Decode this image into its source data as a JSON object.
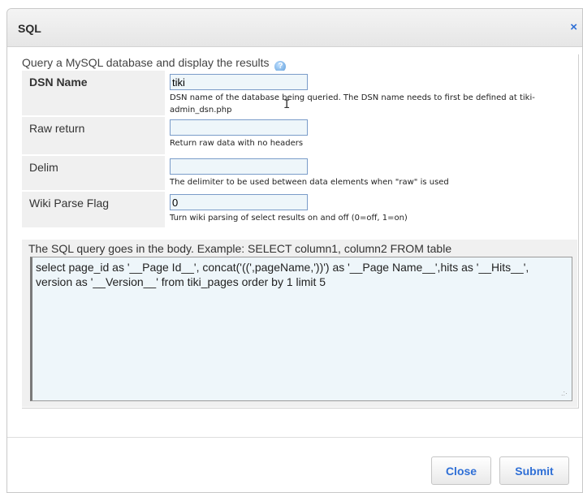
{
  "dialog": {
    "title": "SQL",
    "close_icon": "×"
  },
  "intro": {
    "text": "Query a MySQL database and display the results",
    "help_icon": "?"
  },
  "params": [
    {
      "label": "DSN Name",
      "value": "tiki",
      "help": "DSN name of the database being queried. The DSN name needs to first be defined at tiki-admin_dsn.php"
    },
    {
      "label": "Raw return",
      "value": "",
      "help": "Return raw data with no headers"
    },
    {
      "label": "Delim",
      "value": "",
      "help": "The delimiter to be used between data elements when \"raw\" is used"
    },
    {
      "label": "Wiki Parse Flag",
      "value": "0",
      "help": "Turn wiki parsing of select results on and off (0=off, 1=on)"
    }
  ],
  "body": {
    "label": "The SQL query goes in the body. Example: SELECT column1, column2 FROM table",
    "value": "select page_id as '__Page Id__', concat('((',pageName,'))') as '__Page Name__',hits as '__Hits__', version as '__Version__' from tiki_pages order by 1 limit 5"
  },
  "buttons": {
    "close": "Close",
    "submit": "Submit"
  },
  "colors": {
    "accent": "#2f6fd6",
    "field_bg": "#eef6fa",
    "label_bg": "#f0f0f0"
  }
}
